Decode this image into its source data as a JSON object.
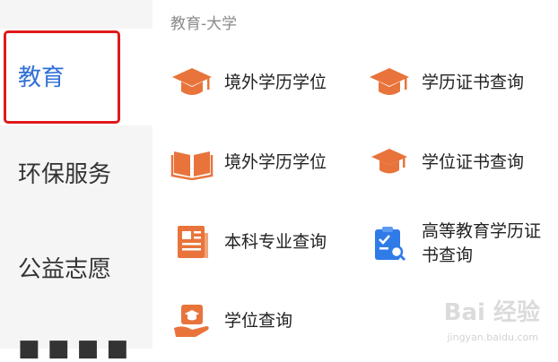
{
  "sidebar": {
    "items": [
      {
        "label": "教育"
      },
      {
        "label": "环保服务"
      },
      {
        "label": "公益志愿"
      }
    ]
  },
  "section": {
    "title": "教育-大学"
  },
  "grid": {
    "items": [
      {
        "label": "境外学历学位",
        "icon": "graduation-cap-icon"
      },
      {
        "label": "学历证书查询",
        "icon": "graduation-cap-icon"
      },
      {
        "label": "境外学历学位",
        "icon": "open-book-icon"
      },
      {
        "label": "学位证书查询",
        "icon": "graduation-cap-icon"
      },
      {
        "label": "本科专业查询",
        "icon": "newspaper-icon"
      },
      {
        "label": "高等教育学历证书查询",
        "icon": "clipboard-search-icon"
      },
      {
        "label": "学位查询",
        "icon": "hand-cap-icon"
      }
    ]
  },
  "watermark": {
    "text": "Bai 经验",
    "sub": "jingyan.baidu.com"
  },
  "colors": {
    "accent": "#2f6fd6",
    "icon_orange": "#e8743b",
    "icon_blue": "#2f7be8",
    "highlight": "#e0191b"
  }
}
